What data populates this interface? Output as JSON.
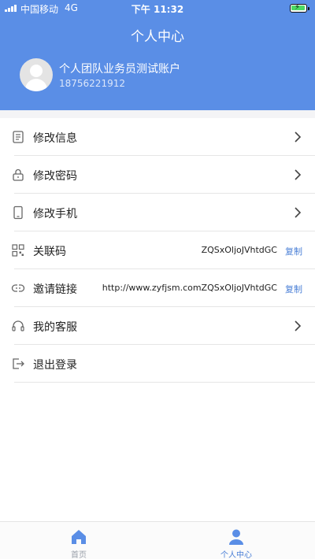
{
  "status_bar": {
    "carrier": "中国移动",
    "network": "4G",
    "time": "下午 11:32",
    "battery_icon": "battery-charging-icon"
  },
  "header": {
    "title": "个人中心",
    "user_name": "个人团队业务员测试账户",
    "user_phone": "18756221912",
    "avatar_icon": "user-avatar-icon"
  },
  "menu": [
    {
      "label": "修改信息",
      "icon": "document-icon",
      "chevron": true
    },
    {
      "label": "修改密码",
      "icon": "lock-icon",
      "chevron": true
    },
    {
      "label": "修改手机",
      "icon": "phone-icon",
      "chevron": true
    },
    {
      "label": "关联码",
      "icon": "qr-code-icon",
      "value": "ZQSxOljoJVhtdGC",
      "action": "复制"
    },
    {
      "label": "邀请链接",
      "icon": "link-icon",
      "value": "http://www.zyfjsm.comZQSxOljoJVhtdGC",
      "action": "复制"
    },
    {
      "label": "我的客服",
      "icon": "headset-icon",
      "chevron": true
    },
    {
      "label": "退出登录",
      "icon": "logout-icon",
      "chevron": false
    }
  ],
  "tabs": [
    {
      "label": "首页",
      "icon": "home-icon",
      "active": false
    },
    {
      "label": "个人中心",
      "icon": "person-icon",
      "active": true
    }
  ],
  "colors": {
    "header_bg": "#5a8ee6",
    "accent": "#4a7fd6",
    "inactive_tab": "#9aa0aa"
  }
}
